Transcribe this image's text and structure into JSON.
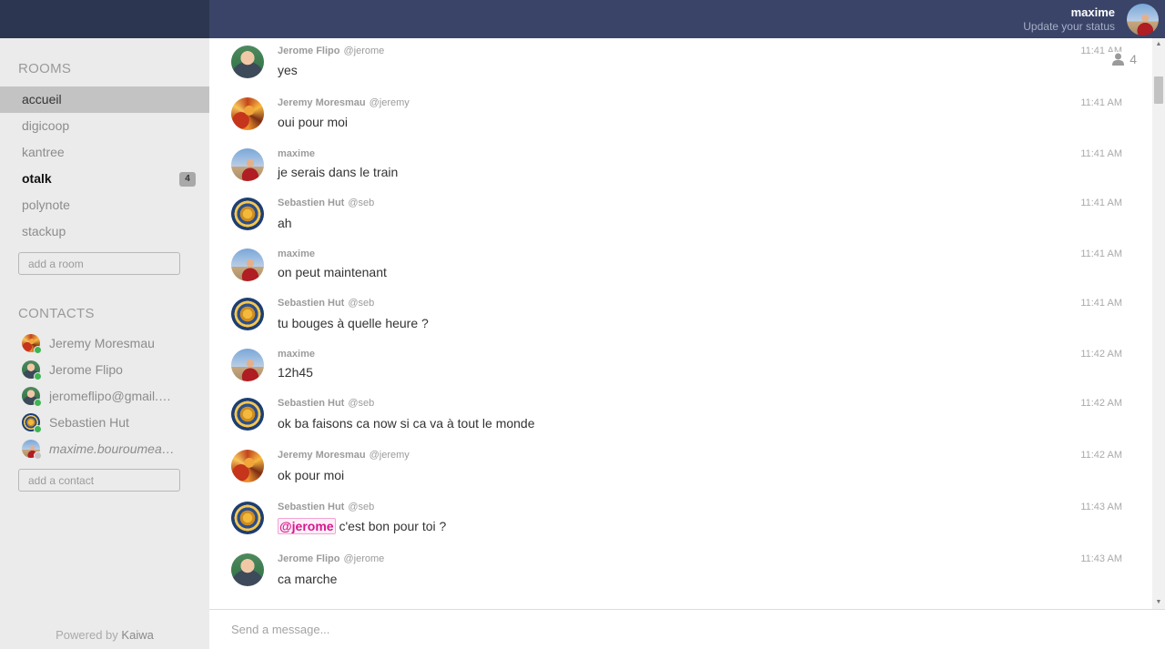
{
  "sidebar": {
    "rooms_title": "ROOMS",
    "rooms": [
      {
        "name": "accueil",
        "active": true
      },
      {
        "name": "digicoop"
      },
      {
        "name": "kantree"
      },
      {
        "name": "otalk",
        "unread": "4"
      },
      {
        "name": "polynote"
      },
      {
        "name": "stackup"
      }
    ],
    "add_room_placeholder": "add a room",
    "contacts_title": "CONTACTS",
    "contacts": [
      {
        "name": "Jeremy Moresmau",
        "status": "online"
      },
      {
        "name": "Jerome Flipo",
        "status": "online"
      },
      {
        "name": "jeromeflipo@gmail.c…",
        "status": "online"
      },
      {
        "name": "Sebastien Hut",
        "status": "online"
      },
      {
        "name": "maxime.bouroumea…",
        "status": "idle"
      }
    ],
    "add_contact_placeholder": "add a contact",
    "powered_by": "Powered by",
    "brand": "Kaiwa"
  },
  "header": {
    "user_name": "maxime",
    "user_status": "Update your status"
  },
  "room": {
    "occupants": "4"
  },
  "messages": [
    {
      "author": "Jerome Flipo",
      "handle": "@jerome",
      "time": "11:41 AM",
      "text": "yes",
      "avatar": "jerome"
    },
    {
      "author": "Jeremy Moresmau",
      "handle": "@jeremy",
      "time": "11:41 AM",
      "text": "oui pour moi",
      "avatar": "jeremy"
    },
    {
      "author": "maxime",
      "handle": "",
      "time": "11:41 AM",
      "text": "je serais dans le train",
      "avatar": "maxime"
    },
    {
      "author": "Sebastien Hut",
      "handle": "@seb",
      "time": "11:41 AM",
      "text": "ah",
      "avatar": "seb"
    },
    {
      "author": "maxime",
      "handle": "",
      "time": "11:41 AM",
      "text": "on peut maintenant",
      "avatar": "maxime"
    },
    {
      "author": "Sebastien Hut",
      "handle": "@seb",
      "time": "11:41 AM",
      "text": "tu bouges à quelle heure ?",
      "avatar": "seb"
    },
    {
      "author": "maxime",
      "handle": "",
      "time": "11:42 AM",
      "text": "12h45",
      "avatar": "maxime"
    },
    {
      "author": "Sebastien Hut",
      "handle": "@seb",
      "time": "11:42 AM",
      "text": "ok ba faisons ca now si ca va à tout le monde",
      "avatar": "seb"
    },
    {
      "author": "Jeremy Moresmau",
      "handle": "@jeremy",
      "time": "11:42 AM",
      "text": "ok pour moi",
      "avatar": "jeremy"
    },
    {
      "author": "Sebastien Hut",
      "handle": "@seb",
      "time": "11:43 AM",
      "mention": "@jerome",
      "text": "c'est bon pour toi ?",
      "avatar": "seb"
    },
    {
      "author": "Jerome Flipo",
      "handle": "@jerome",
      "time": "11:43 AM",
      "text": "ca marche",
      "avatar": "jerome"
    }
  ],
  "composer": {
    "placeholder": "Send a message..."
  }
}
